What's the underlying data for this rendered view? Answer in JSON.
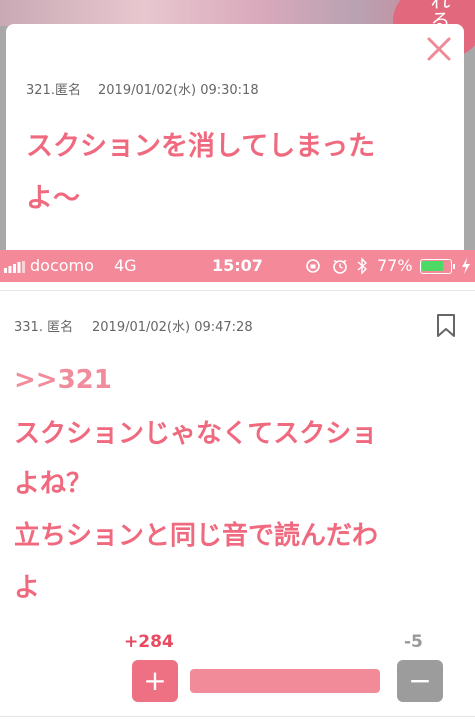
{
  "top_post": {
    "number_label": "321.匿名",
    "timestamp": "2019/01/02(水) 09:30:18",
    "text_line1": "スクションを消してしまった",
    "text_line2": "よ〜",
    "badge_text": "れる"
  },
  "status_bar": {
    "carrier": "docomo",
    "network": "4G",
    "time": "15:07",
    "battery": "77%",
    "battery_level": 0.77
  },
  "post": {
    "number_label": "331. 匿名",
    "timestamp": "2019/01/02(水) 09:47:28",
    "reply_ref": ">>321",
    "lines": [
      "スクションじゃなくてスクショ",
      "よね？",
      "立ちションと同じ音で読んだわ",
      "よ"
    ]
  },
  "votes": {
    "plus_count": "+284",
    "minus_count": "-5",
    "plus_label": "+",
    "minus_label": "−"
  },
  "colors": {
    "accent": "#ef6a7f",
    "status_bar": "#f4899a",
    "vote_plus": "#ee7183",
    "vote_minus": "#9c9c9c"
  }
}
